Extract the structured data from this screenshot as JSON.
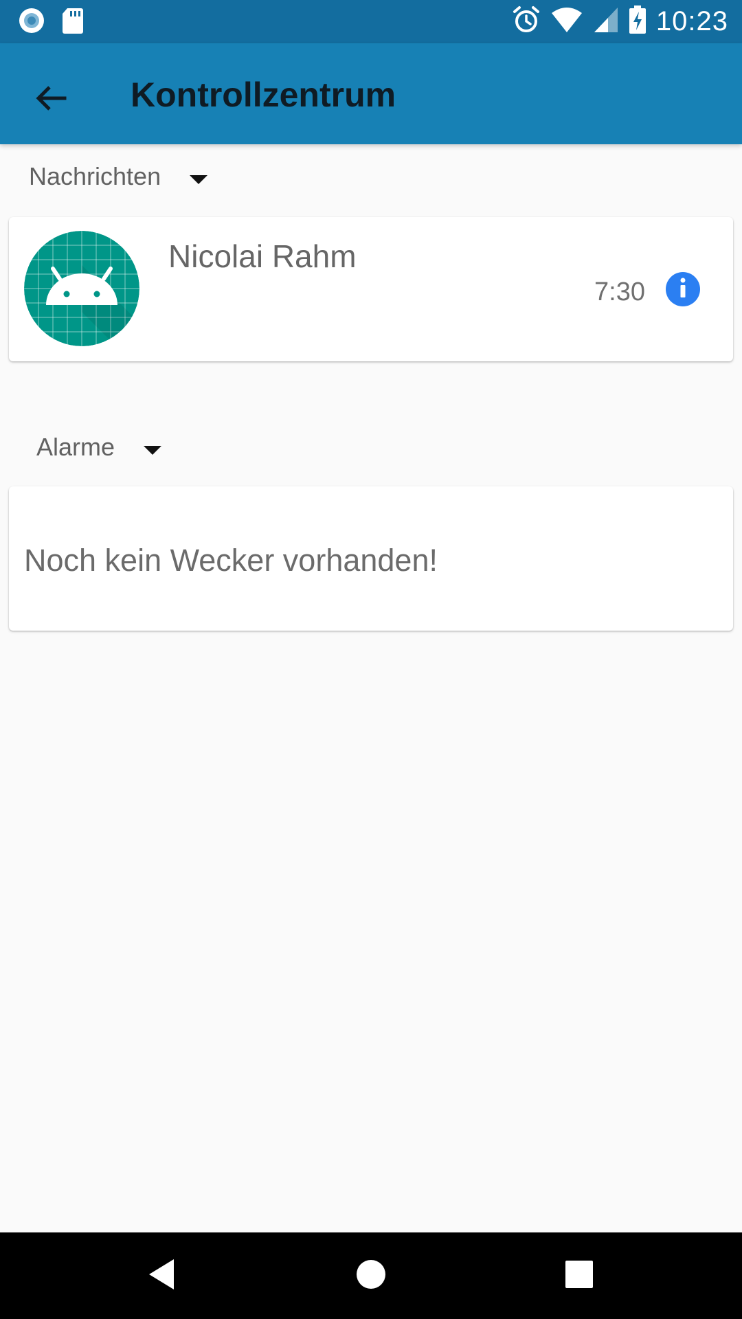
{
  "status_bar": {
    "time": "10:23",
    "icons": [
      "record-icon",
      "sd-card-icon",
      "alarm-icon",
      "wifi-icon",
      "cell-signal-icon",
      "battery-charging-icon"
    ]
  },
  "app_bar": {
    "title": "Kontrollzentrum",
    "back_icon": "arrow-back-icon"
  },
  "messages_section": {
    "label": "Nachrichten",
    "items": [
      {
        "name": "Nicolai Rahm",
        "time": "7:30",
        "avatar": "android-icon",
        "action_icon": "info-icon"
      }
    ]
  },
  "alarms_section": {
    "label": "Alarme",
    "empty_text": "Noch kein Wecker vorhanden!"
  },
  "nav_bar": {
    "buttons": [
      "nav-back-icon",
      "nav-home-icon",
      "nav-recents-icon"
    ]
  },
  "colors": {
    "status_bar": "#136d9f",
    "app_bar": "#1781b5",
    "avatar": "#009688",
    "info": "#2b7ff2"
  }
}
